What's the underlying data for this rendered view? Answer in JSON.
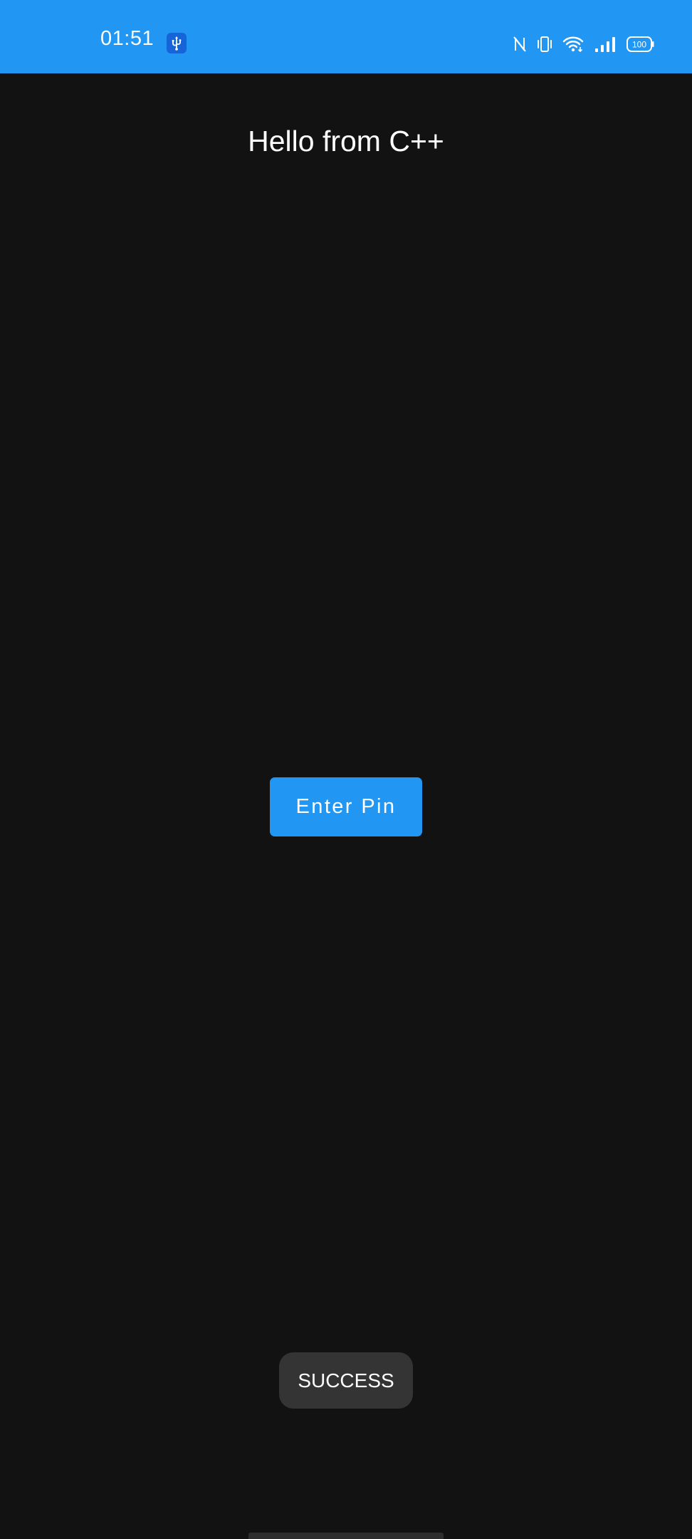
{
  "status_bar": {
    "time": "01:51",
    "battery_level": "100",
    "background_color": "#2196F3",
    "icons": [
      "usb-debugging-icon",
      "nfc-icon",
      "vibrate-icon",
      "wifi-icon",
      "cellular-signal-icon",
      "battery-icon"
    ]
  },
  "main": {
    "title": "Hello from C++",
    "enter_pin_label": "Enter Pin",
    "button_color": "#2196F3",
    "background_color": "#121212"
  },
  "toast": {
    "message": "SUCCESS"
  }
}
